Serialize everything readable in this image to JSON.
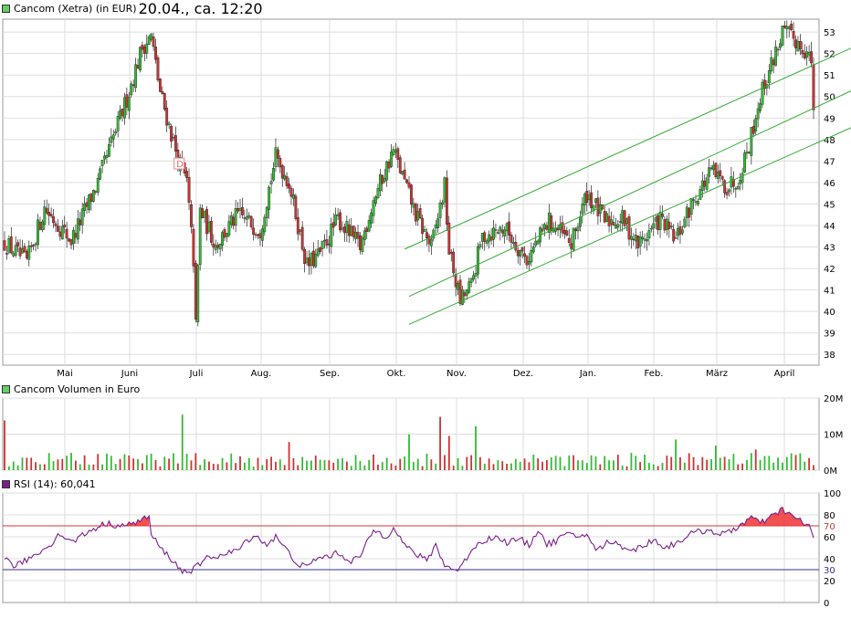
{
  "header": {
    "price_title": "Cancom (Xetra) (in EUR)",
    "timestamp": "20.04., ca. 12:20",
    "volume_title": "Cancom Volumen in Euro",
    "rsi_title": "RSI (14): 60,041"
  },
  "colors": {
    "legend_green": "#66cc66",
    "legend_purple": "#7a1f8c",
    "up_candle": "#33bb33",
    "down_candle": "#cc3333",
    "trend_channel": "#33aa33",
    "rsi_line": "#7a1f8c",
    "rsi_70": "#dd3333",
    "rsi_30": "#333399",
    "rsi_fill": "#ee3333",
    "grid": "#dddddd"
  },
  "chart_data": [
    {
      "type": "candlestick",
      "title": "Cancom (Xetra) (in EUR)",
      "x_labels": [
        "Mai",
        "Juni",
        "Juli",
        "Aug.",
        "Sep.",
        "Okt.",
        "Nov.",
        "Dez.",
        "Jan.",
        "Feb.",
        "März",
        "April"
      ],
      "y_ticks": [
        38,
        39,
        40,
        41,
        42,
        43,
        44,
        45,
        46,
        47,
        48,
        49,
        50,
        51,
        52,
        53
      ],
      "ylim": [
        37.5,
        53.6
      ],
      "grid": true,
      "annotation": "D",
      "keypoints": [
        [
          0,
          43.2
        ],
        [
          10,
          42.3
        ],
        [
          18,
          44.8
        ],
        [
          30,
          43.3
        ],
        [
          42,
          46.0
        ],
        [
          55,
          49.9
        ],
        [
          62,
          52.3
        ],
        [
          66,
          52.8
        ],
        [
          70,
          50.2
        ],
        [
          78,
          47.1
        ],
        [
          82,
          46.0
        ],
        [
          85,
          42.4
        ],
        [
          86,
          39.3
        ],
        [
          88,
          44.7
        ],
        [
          95,
          43.1
        ],
        [
          105,
          44.5
        ],
        [
          115,
          43.8
        ],
        [
          122,
          47.2
        ],
        [
          128,
          46.0
        ],
        [
          136,
          42.1
        ],
        [
          142,
          42.7
        ],
        [
          150,
          44.3
        ],
        [
          160,
          43.0
        ],
        [
          166,
          45.2
        ],
        [
          175,
          47.5
        ],
        [
          185,
          44.5
        ],
        [
          192,
          43.0
        ],
        [
          198,
          45.8
        ],
        [
          200,
          42.8
        ],
        [
          205,
          40.5
        ],
        [
          210,
          41.2
        ],
        [
          215,
          43.5
        ],
        [
          225,
          43.9
        ],
        [
          235,
          42.4
        ],
        [
          245,
          44.2
        ],
        [
          255,
          43.1
        ],
        [
          262,
          45.5
        ],
        [
          270,
          44.2
        ],
        [
          278,
          44.3
        ],
        [
          285,
          43.1
        ],
        [
          295,
          44.3
        ],
        [
          302,
          43.3
        ],
        [
          310,
          45.2
        ],
        [
          318,
          46.5
        ],
        [
          325,
          45.8
        ],
        [
          330,
          46.2
        ],
        [
          335,
          47.8
        ],
        [
          340,
          50.0
        ],
        [
          345,
          51.5
        ],
        [
          350,
          53.0
        ],
        [
          355,
          52.7
        ],
        [
          360,
          52.2
        ],
        [
          363,
          51.6
        ],
        [
          364,
          49.0
        ]
      ],
      "trend_channel": {
        "upper": [
          [
            180,
            42.9
          ],
          [
            372,
            51.9
          ]
        ],
        "middle": [
          [
            182,
            40.7
          ],
          [
            372,
            49.9
          ]
        ],
        "lower": [
          [
            182,
            39.4
          ],
          [
            372,
            48.2
          ]
        ]
      }
    },
    {
      "type": "bar",
      "title": "Cancom Volumen in Euro",
      "y_ticks": [
        "0M",
        "10M",
        "20M"
      ],
      "ylim": [
        0,
        20
      ],
      "unit": "M EUR",
      "spikes": [
        [
          0,
          13.8
        ],
        [
          55,
          10.8
        ],
        [
          80,
          15.4
        ],
        [
          128,
          7.8
        ],
        [
          155,
          6.8
        ],
        [
          182,
          9.9
        ],
        [
          196,
          14.8
        ],
        [
          200,
          9.5
        ],
        [
          212,
          12.2
        ],
        [
          215,
          5.5
        ],
        [
          302,
          8.5
        ],
        [
          320,
          6.8
        ],
        [
          338,
          5.7
        ],
        [
          345,
          6.1
        ],
        [
          355,
          4.8
        ]
      ]
    },
    {
      "type": "line",
      "title": "RSI (14): 60,041",
      "y_ticks": [
        0,
        20,
        30,
        40,
        60,
        70,
        80,
        100
      ],
      "ylim": [
        0,
        100
      ],
      "reference_lines": [
        70,
        30
      ],
      "last_value": 60.041,
      "keypoints": [
        [
          0,
          40
        ],
        [
          5,
          33
        ],
        [
          15,
          45
        ],
        [
          20,
          52
        ],
        [
          25,
          63
        ],
        [
          30,
          55
        ],
        [
          38,
          65
        ],
        [
          45,
          72
        ],
        [
          55,
          70
        ],
        [
          62,
          76
        ],
        [
          65,
          78
        ],
        [
          66,
          62
        ],
        [
          70,
          50
        ],
        [
          75,
          40
        ],
        [
          80,
          28
        ],
        [
          85,
          30
        ],
        [
          92,
          42
        ],
        [
          98,
          43
        ],
        [
          105,
          48
        ],
        [
          112,
          62
        ],
        [
          118,
          53
        ],
        [
          122,
          60
        ],
        [
          126,
          50
        ],
        [
          132,
          35
        ],
        [
          136,
          32
        ],
        [
          140,
          40
        ],
        [
          145,
          42
        ],
        [
          150,
          45
        ],
        [
          156,
          38
        ],
        [
          160,
          42
        ],
        [
          166,
          66
        ],
        [
          172,
          60
        ],
        [
          175,
          70
        ],
        [
          180,
          52
        ],
        [
          186,
          43
        ],
        [
          190,
          38
        ],
        [
          194,
          53
        ],
        [
          198,
          34
        ],
        [
          202,
          30
        ],
        [
          205,
          31
        ],
        [
          210,
          48
        ],
        [
          214,
          55
        ],
        [
          220,
          60
        ],
        [
          226,
          55
        ],
        [
          232,
          58
        ],
        [
          236,
          52
        ],
        [
          240,
          67
        ],
        [
          244,
          53
        ],
        [
          248,
          56
        ],
        [
          252,
          62
        ],
        [
          258,
          60
        ],
        [
          262,
          63
        ],
        [
          266,
          47
        ],
        [
          272,
          56
        ],
        [
          277,
          52
        ],
        [
          283,
          48
        ],
        [
          288,
          52
        ],
        [
          292,
          58
        ],
        [
          297,
          50
        ],
        [
          302,
          54
        ],
        [
          308,
          62
        ],
        [
          313,
          65
        ],
        [
          318,
          66
        ],
        [
          322,
          62
        ],
        [
          326,
          64
        ],
        [
          332,
          72
        ],
        [
          336,
          78
        ],
        [
          340,
          72
        ],
        [
          345,
          78
        ],
        [
          350,
          85
        ],
        [
          355,
          78
        ],
        [
          360,
          72
        ],
        [
          362,
          70
        ],
        [
          364,
          60
        ]
      ]
    }
  ]
}
